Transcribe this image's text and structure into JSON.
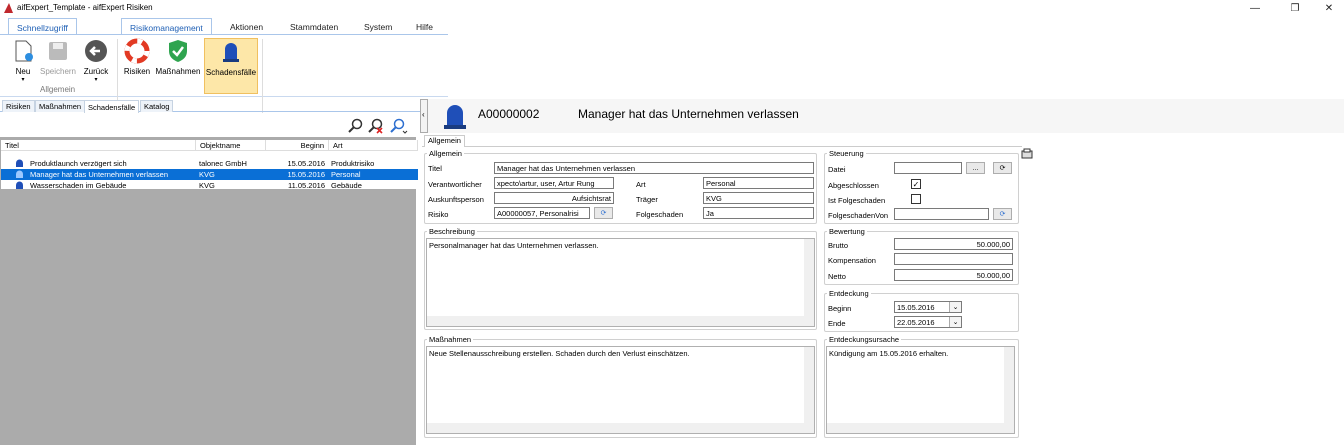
{
  "window": {
    "title": "aifExpert_Template - aifExpert Risiken"
  },
  "ribbon": {
    "tabs": [
      "Schnellzugriff",
      "Risikomanagement",
      "Aktionen",
      "Stammdaten",
      "System",
      "Hilfe"
    ],
    "buttons": {
      "neu": "Neu",
      "speichern": "Speichern",
      "zurueck": "Zurück",
      "risiken": "Risiken",
      "massnahmen": "Maßnahmen",
      "schadensfaelle": "Schadensfälle"
    },
    "group_label": "Allgemein"
  },
  "left": {
    "tabs": [
      "Risiken",
      "Maßnahmen",
      "Schadensfälle",
      "Katalog"
    ],
    "columns": [
      "Titel",
      "Objektname",
      "Beginn",
      "Art"
    ],
    "rows": [
      {
        "titel": "Produktlaunch verzögert sich",
        "objekt": "talonec GmbH",
        "beginn": "15.05.2016",
        "art": "Produktrisiko"
      },
      {
        "titel": "Manager hat das Unternehmen verlassen",
        "objekt": "KVG",
        "beginn": "15.05.2016",
        "art": "Personal"
      },
      {
        "titel": "Wasserschaden im Gebäude",
        "objekt": "KVG",
        "beginn": "11.05.2016",
        "art": "Gebäude"
      }
    ]
  },
  "detail": {
    "id": "A00000002",
    "title": "Manager hat das Unternehmen verlassen",
    "tab": "Allgemein",
    "allgemein": {
      "legend": "Allgemein",
      "titel_label": "Titel",
      "titel": "Manager hat das Unternehmen verlassen",
      "verantw_label": "Verantwortlicher",
      "verantw": "xpecto\\artur, user, Artur Rung",
      "art_label": "Art",
      "art": "Personal",
      "ausk_label": "Auskunftsperson",
      "ausk": "Aufsichtsrat",
      "traeger_label": "Träger",
      "traeger": "KVG",
      "risiko_label": "Risiko",
      "risiko": "A00000057, Personalrisi",
      "folge_label": "Folgeschaden",
      "folge": "Ja"
    },
    "beschreibung": {
      "legend": "Beschreibung",
      "text": "Personalmanager hat das Unternehmen verlassen."
    },
    "massnahmen": {
      "legend": "Maßnahmen",
      "text": "Neue Stellenausschreibung erstellen. Schaden durch den Verlust einschätzen."
    },
    "steuerung": {
      "legend": "Steuerung",
      "datei": "Datei",
      "abgeschlossen": "Abgeschlossen",
      "ist_folge": "Ist Folgeschaden",
      "folge_von": "FolgeschadenVon",
      "browse": "..."
    },
    "bewertung": {
      "legend": "Bewertung",
      "brutto_label": "Brutto",
      "brutto": "50.000,00",
      "komp_label": "Kompensation",
      "komp": "",
      "netto_label": "Netto",
      "netto": "50.000,00"
    },
    "entdeckung": {
      "legend": "Entdeckung",
      "beginn_label": "Beginn",
      "beginn": "15.05.2016",
      "ende_label": "Ende",
      "ende": "22.05.2016"
    },
    "ursache": {
      "legend": "Entdeckungsursache",
      "text": "Kündigung am 15.05.2016 erhalten."
    }
  }
}
